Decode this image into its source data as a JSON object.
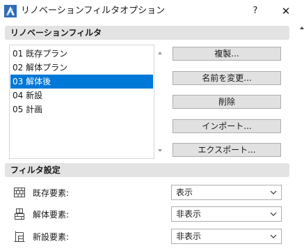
{
  "window": {
    "title": "リノベーションフィルタオプション",
    "help": "?",
    "close": "✕"
  },
  "renovation_section": {
    "title": "リノベーションフィルタ"
  },
  "filters": [
    {
      "label": "01 既存プラン",
      "selected": false
    },
    {
      "label": "02 解体プラン",
      "selected": false
    },
    {
      "label": "03 解体後",
      "selected": true
    },
    {
      "label": "04 新設",
      "selected": false
    },
    {
      "label": "05 計画",
      "selected": false
    }
  ],
  "buttons": {
    "duplicate": "複製...",
    "rename": "名前を変更...",
    "delete": "削除",
    "import": "インポート...",
    "export": "エクスポート..."
  },
  "settings_section": {
    "title": "フィルタ設定"
  },
  "settings": {
    "existing": {
      "label": "既存要素:",
      "value": "表示"
    },
    "demolished": {
      "label": "解体要素:",
      "value": "非表示"
    },
    "new": {
      "label": "新設要素:",
      "value": "非表示"
    }
  },
  "colors": {
    "selection": "#0078d7",
    "section_bar": "#e3e3e3",
    "button_face": "#e1e1e1"
  }
}
